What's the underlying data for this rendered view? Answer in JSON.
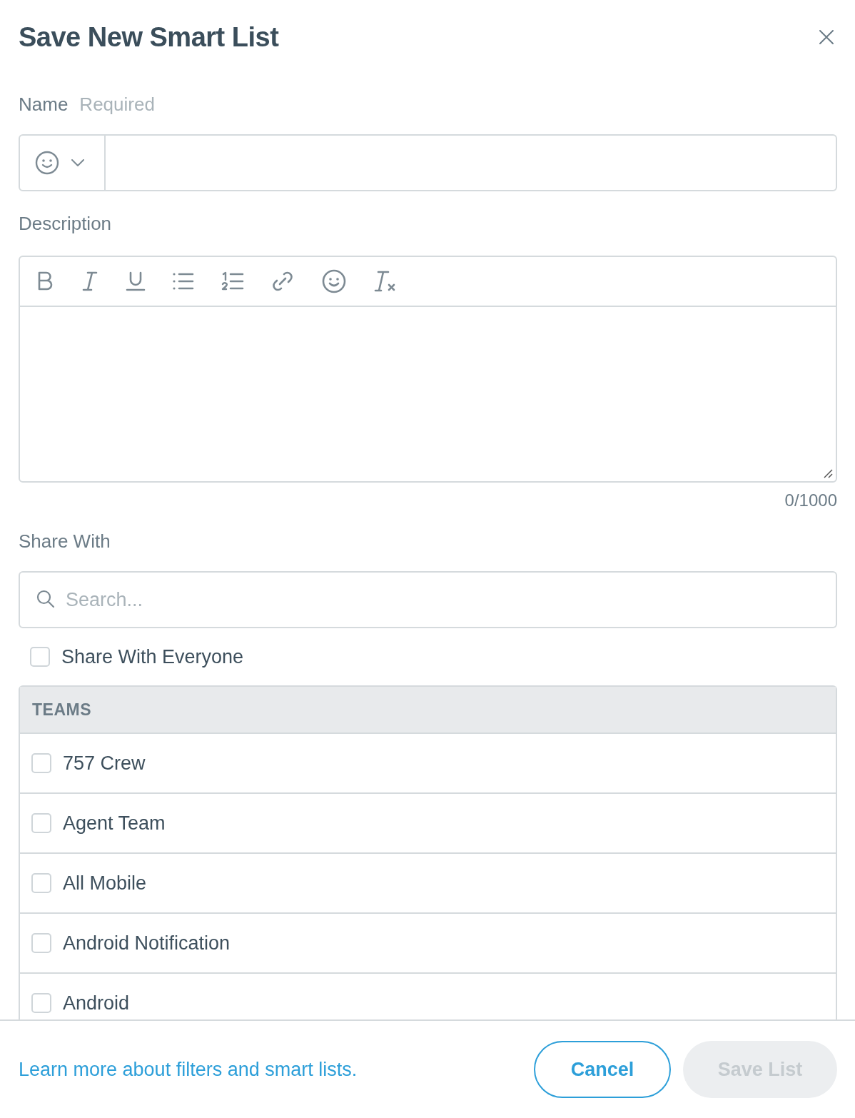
{
  "dialog": {
    "title": "Save New Smart List"
  },
  "name_field": {
    "label": "Name",
    "hint": "Required"
  },
  "description": {
    "label": "Description",
    "counter": "0/1000"
  },
  "share": {
    "label": "Share With",
    "search": {
      "placeholder": "Search..."
    },
    "everyone": {
      "label": "Share With Everyone",
      "checked": false
    }
  },
  "teams": {
    "header": "TEAMS",
    "items": [
      {
        "label": "757 Crew",
        "checked": false
      },
      {
        "label": "Agent Team",
        "checked": false
      },
      {
        "label": "All Mobile",
        "checked": false
      },
      {
        "label": "Android Notification",
        "checked": false
      },
      {
        "label": "Android",
        "checked": false
      }
    ]
  },
  "footer": {
    "link": "Learn more about filters and smart lists.",
    "cancel": "Cancel",
    "save": {
      "label": "Save List",
      "disabled": true
    }
  }
}
